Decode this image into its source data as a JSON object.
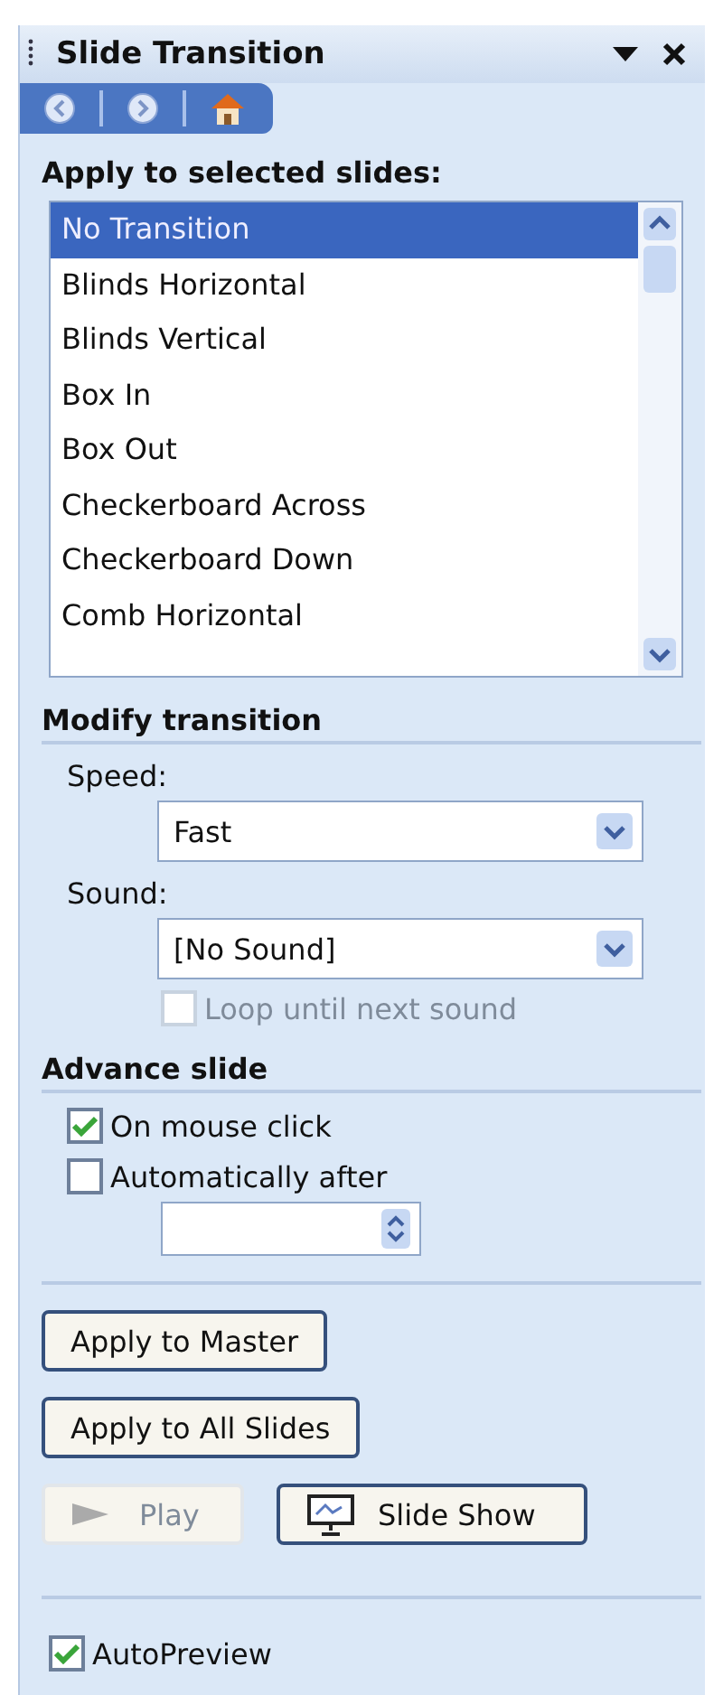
{
  "pane": {
    "title": "Slide Transition"
  },
  "apply_section": {
    "heading": "Apply to selected slides:",
    "items": [
      {
        "label": "No Transition",
        "selected": true
      },
      {
        "label": "Blinds Horizontal",
        "selected": false
      },
      {
        "label": "Blinds Vertical",
        "selected": false
      },
      {
        "label": "Box In",
        "selected": false
      },
      {
        "label": "Box Out",
        "selected": false
      },
      {
        "label": "Checkerboard Across",
        "selected": false
      },
      {
        "label": "Checkerboard Down",
        "selected": false
      },
      {
        "label": "Comb Horizontal",
        "selected": false
      }
    ]
  },
  "modify_section": {
    "heading": "Modify transition",
    "speed_label": "Speed:",
    "speed_value": "Fast",
    "sound_label": "Sound:",
    "sound_value": "[No Sound]",
    "loop": {
      "label": "Loop until next sound",
      "checked": false,
      "disabled": true
    }
  },
  "advance_section": {
    "heading": "Advance slide",
    "on_click": {
      "label": "On mouse click",
      "checked": true
    },
    "automatically": {
      "label": "Automatically after",
      "checked": false
    }
  },
  "buttons": {
    "apply_master": "Apply to Master",
    "apply_all": "Apply to All Slides",
    "play": {
      "label": "Play",
      "disabled": true
    },
    "slide_show": "Slide Show"
  },
  "autopreview": {
    "label": "AutoPreview",
    "checked": true
  }
}
